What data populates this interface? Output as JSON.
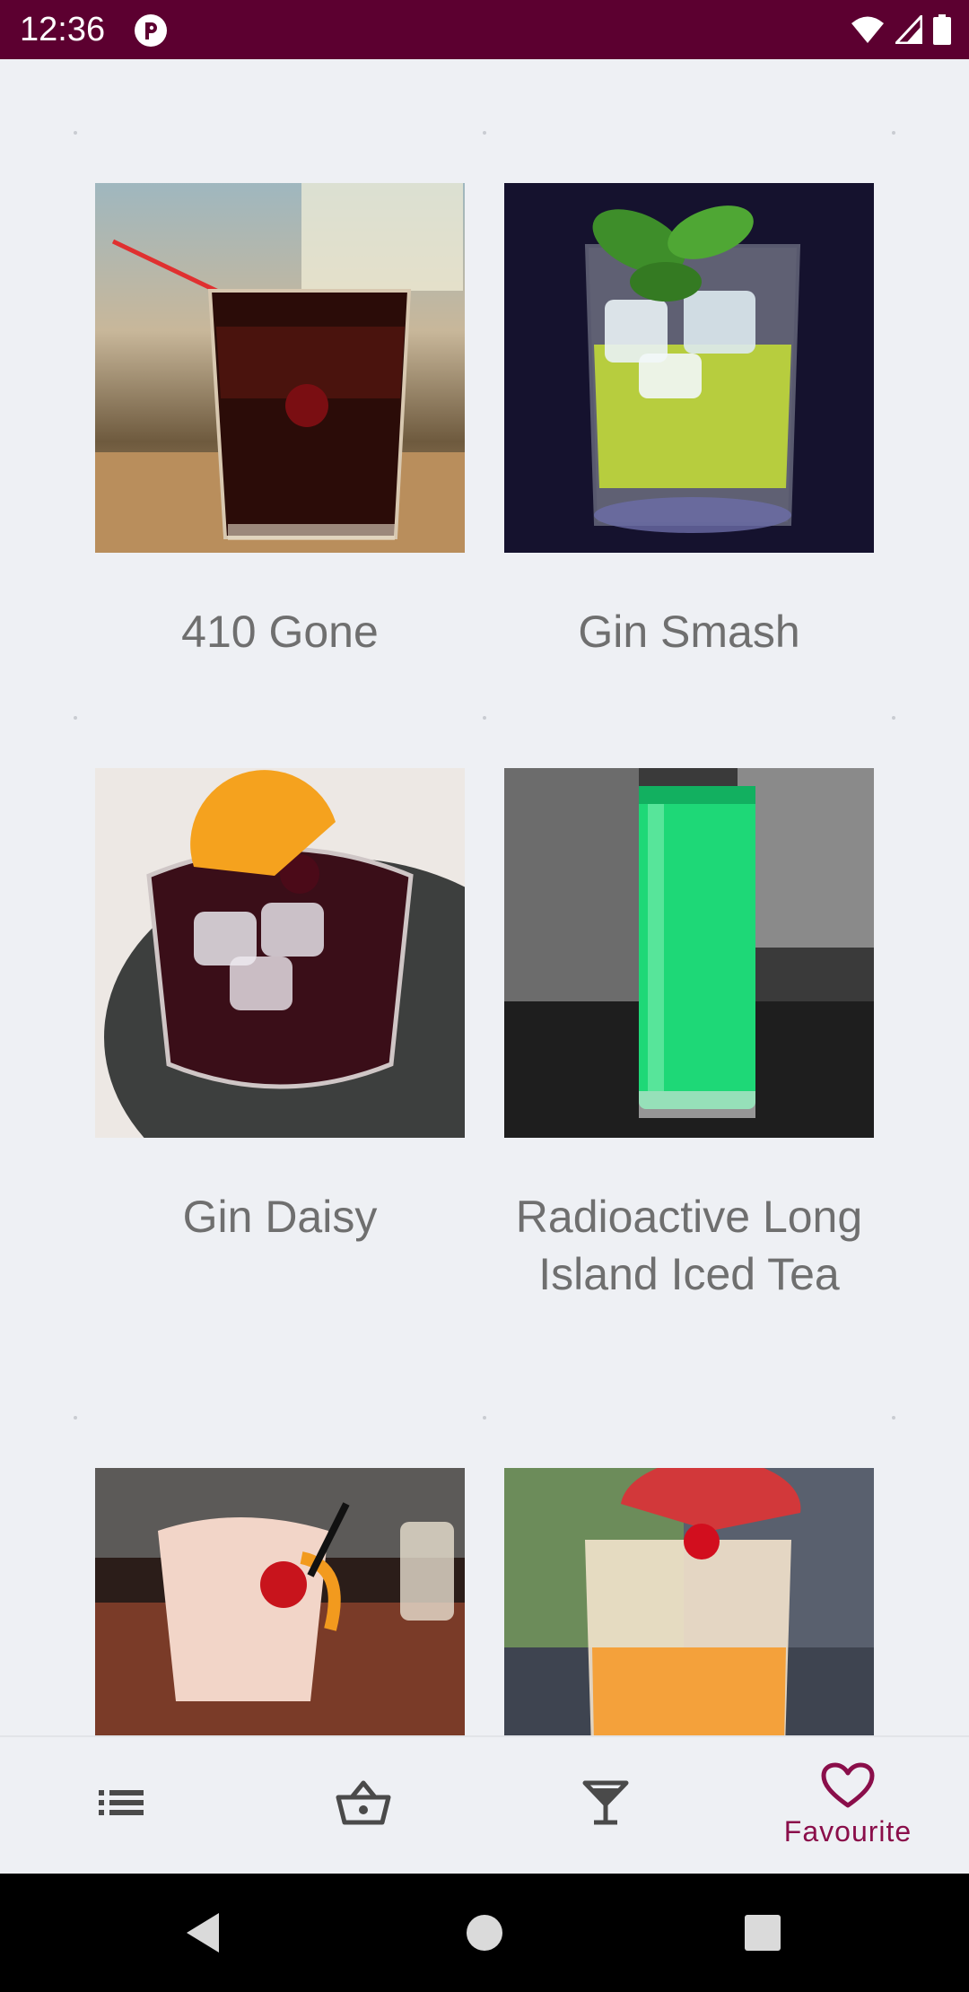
{
  "status_bar": {
    "time": "12:36",
    "icons": [
      "app-notification-icon",
      "wifi-icon",
      "signal-icon",
      "battery-icon"
    ],
    "background": "#5C0030"
  },
  "cocktails": [
    {
      "name": "410 Gone",
      "image": "cola-drink-with-cherry-photo"
    },
    {
      "name": "Gin Smash",
      "image": "lime-drink-with-basil-photo"
    },
    {
      "name": "Gin Daisy",
      "image": "red-drink-with-orange-slice-photo"
    },
    {
      "name": "Radioactive Long Island Iced Tea",
      "image": "green-tall-drink-photo"
    },
    {
      "name": "",
      "image": "creamy-drink-with-cherry-photo"
    },
    {
      "name": "",
      "image": "orange-drink-with-grapefruit-photo"
    }
  ],
  "bottom_nav": {
    "items": [
      {
        "icon": "list-icon",
        "label": "",
        "selected": false
      },
      {
        "icon": "basket-icon",
        "label": "",
        "selected": false
      },
      {
        "icon": "cocktail-glass-icon",
        "label": "",
        "selected": false
      },
      {
        "icon": "heart-icon",
        "label": "Favourite",
        "selected": true
      }
    ],
    "active_color": "#8A0E4A",
    "inactive_color": "#4A4A4A"
  },
  "system_nav": {
    "buttons": [
      "back-icon",
      "home-icon",
      "recents-icon"
    ]
  }
}
